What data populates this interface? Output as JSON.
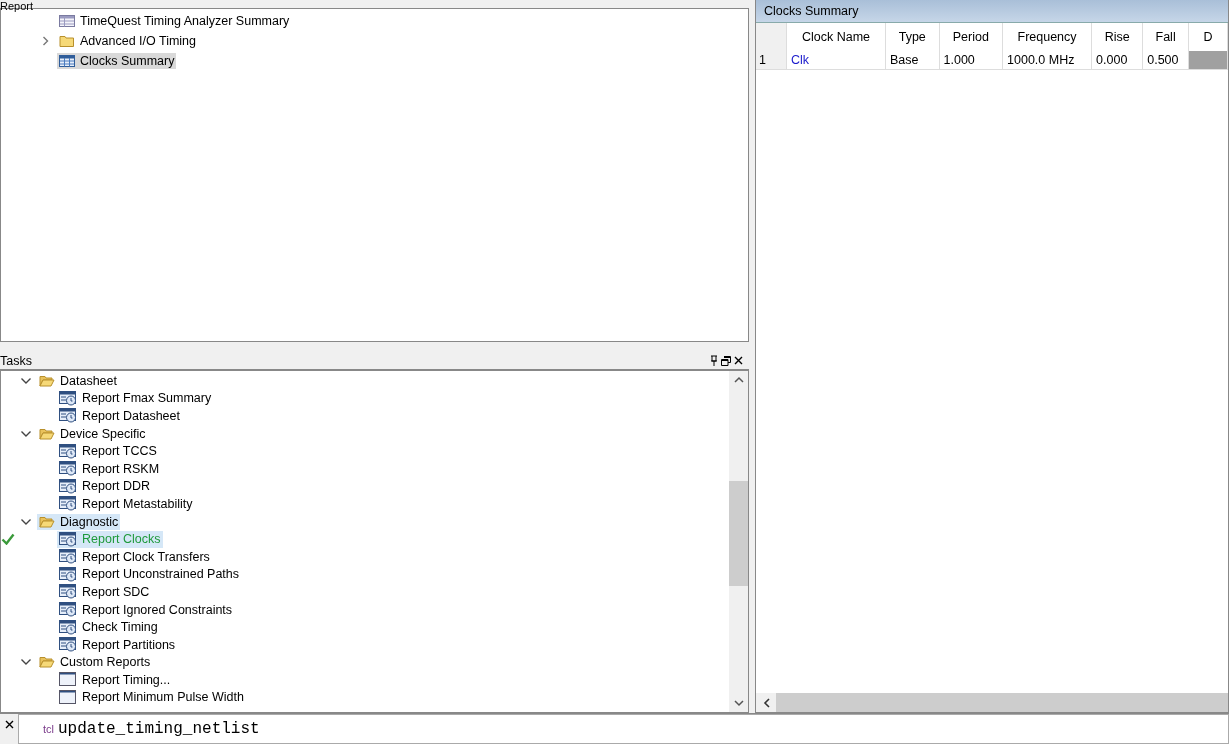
{
  "report_panel": {
    "title": "Report",
    "tree": [
      {
        "label": "TimeQuest Timing Analyzer Summary",
        "kind": "summary",
        "selected": false
      },
      {
        "label": "Advanced I/O Timing",
        "kind": "folder",
        "expanded": false,
        "selected": false
      },
      {
        "label": "Clocks Summary",
        "kind": "table",
        "selected": true
      }
    ]
  },
  "tasks_panel": {
    "title": "Tasks",
    "tree": [
      {
        "label": "Datasheet",
        "kind": "folder",
        "expanded": true,
        "selected": false,
        "children": [
          {
            "label": "Report Fmax Summary",
            "kind": "report",
            "selected": false,
            "done": false
          },
          {
            "label": "Report Datasheet",
            "kind": "report",
            "selected": false,
            "done": false
          }
        ]
      },
      {
        "label": "Device Specific",
        "kind": "folder",
        "expanded": true,
        "selected": false,
        "children": [
          {
            "label": "Report TCCS",
            "kind": "report",
            "selected": false,
            "done": false
          },
          {
            "label": "Report RSKM",
            "kind": "report",
            "selected": false,
            "done": false
          },
          {
            "label": "Report DDR",
            "kind": "report",
            "selected": false,
            "done": false
          },
          {
            "label": "Report Metastability",
            "kind": "report",
            "selected": false,
            "done": false
          }
        ]
      },
      {
        "label": "Diagnostic",
        "kind": "folder",
        "expanded": true,
        "selected": true,
        "children": [
          {
            "label": "Report Clocks",
            "kind": "report",
            "selected": true,
            "done": true
          },
          {
            "label": "Report Clock Transfers",
            "kind": "report",
            "selected": false,
            "done": false
          },
          {
            "label": "Report Unconstrained Paths",
            "kind": "report",
            "selected": false,
            "done": false
          },
          {
            "label": "Report SDC",
            "kind": "report",
            "selected": false,
            "done": false
          },
          {
            "label": "Report Ignored Constraints",
            "kind": "report",
            "selected": false,
            "done": false
          },
          {
            "label": "Check Timing",
            "kind": "report",
            "selected": false,
            "done": false
          },
          {
            "label": "Report Partitions",
            "kind": "report",
            "selected": false,
            "done": false
          }
        ]
      },
      {
        "label": "Custom Reports",
        "kind": "folder",
        "expanded": true,
        "selected": false,
        "children": [
          {
            "label": "Report Timing...",
            "kind": "custom",
            "selected": false,
            "done": false
          },
          {
            "label": "Report Minimum Pulse Width",
            "kind": "custom",
            "selected": false,
            "done": false
          }
        ]
      }
    ]
  },
  "clocks_summary": {
    "title": "Clocks Summary",
    "table": {
      "columns": [
        "Clock Name",
        "Type",
        "Period",
        "Frequency",
        "Rise",
        "Fall",
        "D"
      ],
      "rows": [
        {
          "index": "1",
          "cells": [
            "Clk",
            "Base",
            "1.000",
            "1000.0 MHz",
            "0.000",
            "0.500",
            ""
          ]
        }
      ]
    }
  },
  "console": {
    "prompt": "tcl",
    "value": "update_timing_netlist"
  }
}
